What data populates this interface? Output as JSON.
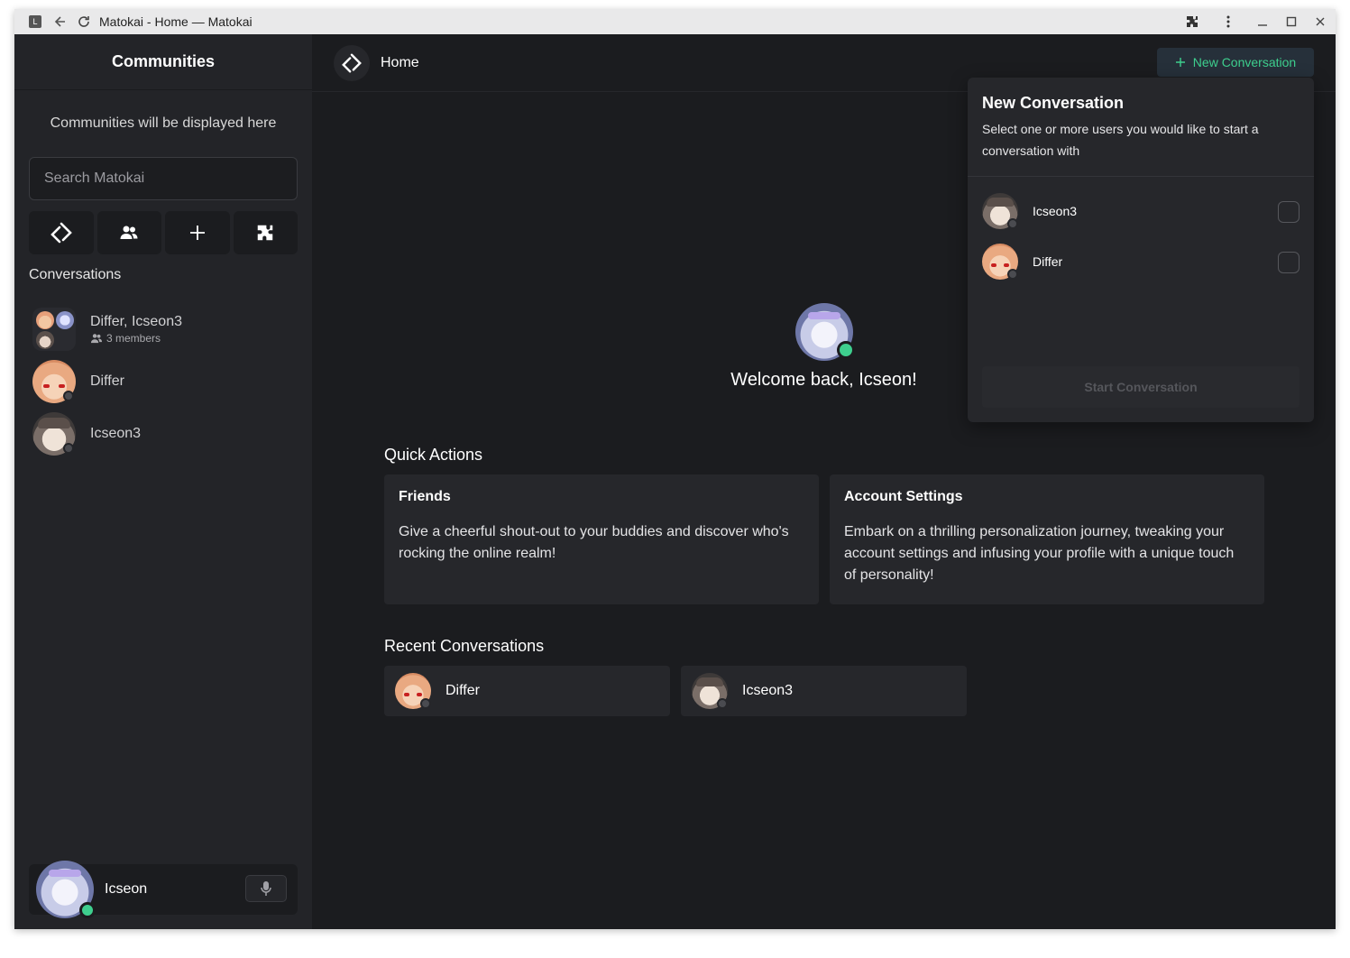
{
  "browser": {
    "title": "Matokai - Home — Matokai"
  },
  "sidebar": {
    "header": "Communities",
    "communities_note": "Communities will be displayed here",
    "search_placeholder": "Search Matokai",
    "conversations_title": "Conversations",
    "conversations": [
      {
        "name": "Differ, Icseon3",
        "members": "3 members"
      },
      {
        "name": "Differ"
      },
      {
        "name": "Icseon3"
      }
    ],
    "user": {
      "name": "Icseon"
    }
  },
  "topbar": {
    "title": "Home",
    "new_conversation": "New Conversation"
  },
  "welcome": {
    "text": "Welcome back, Icseon!"
  },
  "quick_actions": {
    "title": "Quick Actions",
    "cards": [
      {
        "title": "Friends",
        "desc": "Give a cheerful shout-out to your buddies and discover who's rocking the online realm!"
      },
      {
        "title": "Account Settings",
        "desc": "Embark on a thrilling personalization journey, tweaking your account settings and infusing your profile with a unique touch of personality!"
      }
    ]
  },
  "recent": {
    "title": "Recent Conversations",
    "items": [
      {
        "name": "Differ"
      },
      {
        "name": "Icseon3"
      }
    ]
  },
  "popover": {
    "title": "New Conversation",
    "desc": "Select one or more users you would like to start a conversation with",
    "users": [
      {
        "name": "Icseon3",
        "checked": false
      },
      {
        "name": "Differ",
        "checked": false
      }
    ],
    "start_button": "Start Conversation"
  },
  "colors": {
    "accent_green": "#3ecf8e",
    "online": "#3ecf8e",
    "offline": "#4a4b50",
    "bg": "#1b1c1f",
    "panel": "#232428"
  }
}
